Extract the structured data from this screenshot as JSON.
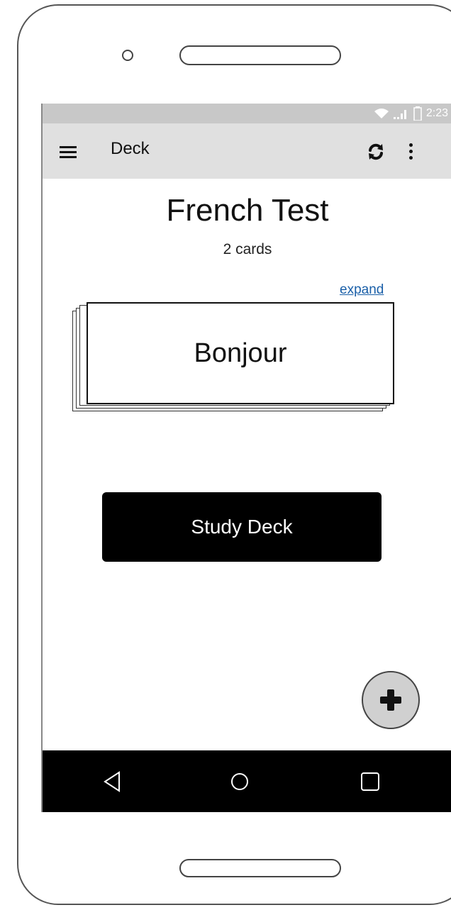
{
  "status_bar": {
    "time": "2:23",
    "wifi_icon": "wifi-icon",
    "signal_icon": "signal-icon",
    "battery_icon": "battery-icon"
  },
  "app_bar": {
    "title": "Deck",
    "menu_icon": "hamburger-menu-icon",
    "sync_icon": "sync-icon",
    "more_icon": "more-vertical-icon",
    "background": "#e0e0e0"
  },
  "deck": {
    "name": "French Test",
    "count_label": "2 cards",
    "expand_label": "expand",
    "top_card_text": "Bonjour"
  },
  "study_button": {
    "label": "Study Deck",
    "background": "#000000"
  },
  "fab": {
    "icon": "plus-icon",
    "background": "#d0d0d0"
  },
  "nav_bar": {
    "back_icon": "back-triangle-icon",
    "home_icon": "home-circle-icon",
    "recents_icon": "recents-square-icon",
    "background": "#000000"
  },
  "colors": {
    "link": "#1a5fa8",
    "status_bar": "#c8c8c8"
  }
}
